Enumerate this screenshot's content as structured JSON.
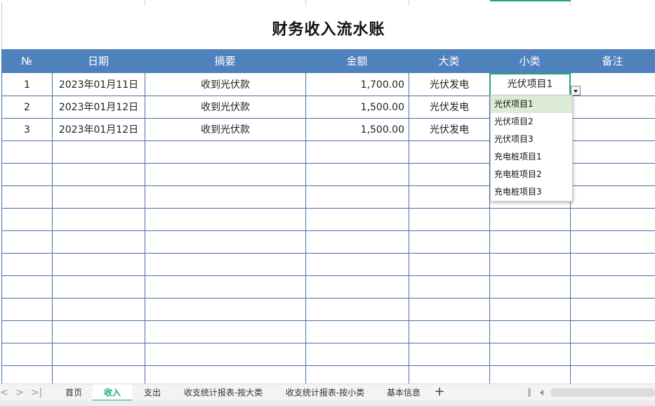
{
  "sheet": {
    "title": "财务收入流水账",
    "headers": {
      "no": "№",
      "date": "日期",
      "summary": "摘要",
      "amount": "金额",
      "category": "大类",
      "subcategory": "小类",
      "note": "备注"
    },
    "rows": [
      {
        "no": "1",
        "date": "2023年01月11日",
        "summary": "收到光伏款",
        "amount": "1,700.00",
        "category": "光伏发电",
        "subcategory": "光伏项目1",
        "note": ""
      },
      {
        "no": "2",
        "date": "2023年01月12日",
        "summary": "收到光伏款",
        "amount": "1,500.00",
        "category": "光伏发电",
        "subcategory": "",
        "note": ""
      },
      {
        "no": "3",
        "date": "2023年01月12日",
        "summary": "收到光伏款",
        "amount": "1,500.00",
        "category": "光伏发电",
        "subcategory": "",
        "note": ""
      }
    ]
  },
  "dropdown": {
    "options": [
      "光伏项目1",
      "光伏项目2",
      "光伏项目3",
      "充电桩项目1",
      "充电桩项目2",
      "充电桩项目3"
    ],
    "selected": "光伏项目1"
  },
  "tabs": {
    "items": [
      "首页",
      "收入",
      "支出",
      "收支统计报表-按大类",
      "收支统计报表-按小类",
      "基本信息"
    ],
    "active": "收入",
    "add": "+"
  },
  "nav": {
    "first": "<",
    "prev": ">",
    "last": ">|"
  },
  "colors": {
    "header_bg": "#4f81bd",
    "accent": "#1fa971",
    "grid": "#4a6fa5",
    "dropdown_highlight": "#dcebd5"
  }
}
